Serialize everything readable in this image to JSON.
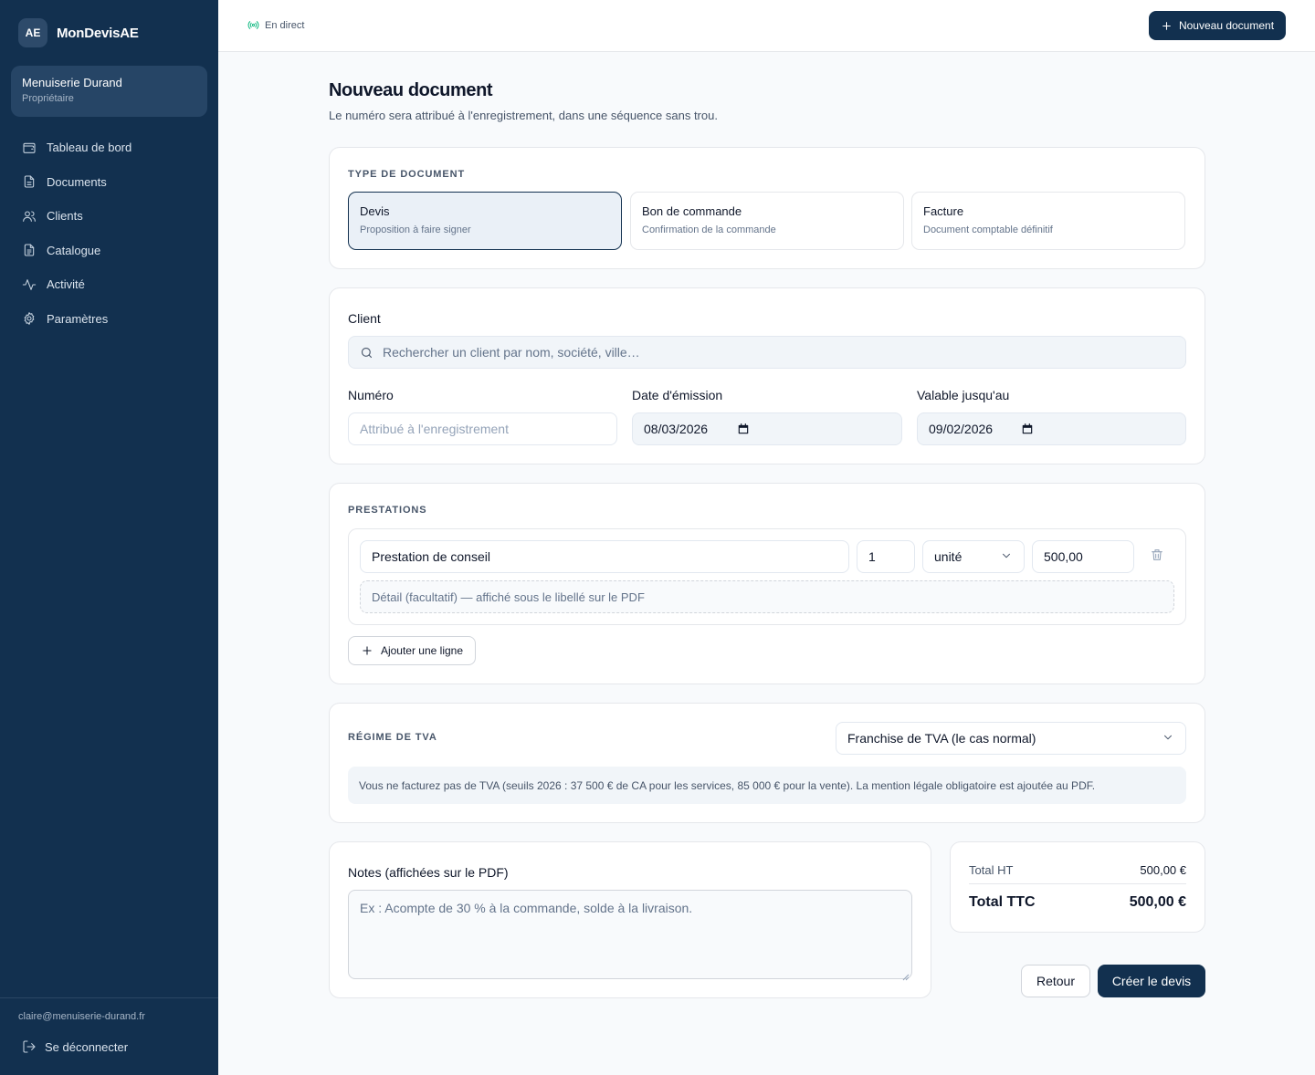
{
  "sidebar": {
    "brand_badge": "AE",
    "brand_name": "MonDevisAE",
    "org_name": "Menuiserie Durand",
    "org_role": "Propriétaire",
    "items": [
      {
        "label": "Tableau de bord",
        "icon": "wallet-icon"
      },
      {
        "label": "Documents",
        "icon": "document-icon"
      },
      {
        "label": "Clients",
        "icon": "users-icon"
      },
      {
        "label": "Catalogue",
        "icon": "catalog-icon"
      },
      {
        "label": "Activité",
        "icon": "activity-icon"
      },
      {
        "label": "Paramètres",
        "icon": "gear-icon"
      }
    ],
    "email": "claire@menuiserie-durand.fr",
    "logout": "Se déconnecter"
  },
  "topbar": {
    "live": "En direct",
    "new_document": "Nouveau document"
  },
  "page": {
    "title": "Nouveau document",
    "subtitle": "Le numéro sera attribué à l'enregistrement, dans une séquence sans trou."
  },
  "doc_type": {
    "label": "Type de document",
    "options": [
      {
        "name": "Devis",
        "desc": "Proposition à faire signer",
        "selected": true
      },
      {
        "name": "Bon de commande",
        "desc": "Confirmation de la commande",
        "selected": false
      },
      {
        "name": "Facture",
        "desc": "Document comptable définitif",
        "selected": false
      }
    ]
  },
  "client": {
    "label": "Client",
    "search_placeholder": "Rechercher un client par nom, société, ville…",
    "numero_label": "Numéro",
    "numero_placeholder": "Attribué à l'enregistrement",
    "date_label": "Date d'émission",
    "date_value": "08/03/2026",
    "valid_label": "Valable jusqu'au",
    "valid_value": "09/02/2026"
  },
  "prestations": {
    "label": "Prestations",
    "lines": [
      {
        "label": "Prestation de conseil",
        "qty": "1",
        "unit": "unité",
        "price": "500,00",
        "detail_placeholder": "Détail (facultatif) — affiché sous le libellé sur le PDF"
      }
    ],
    "add_line": "Ajouter une ligne"
  },
  "tva": {
    "label": "Régime de TVA",
    "selected": "Franchise de TVA (le cas normal)",
    "info": "Vous ne facturez pas de TVA (seuils 2026 : 37 500 € de CA pour les services, 85 000 € pour la vente). La mention légale obligatoire est ajoutée au PDF."
  },
  "notes": {
    "label": "Notes (affichées sur le PDF)",
    "placeholder": "Ex : Acompte de 30 % à la commande, solde à la livraison."
  },
  "totals": {
    "ht_label": "Total HT",
    "ht_value": "500,00 €",
    "ttc_label": "Total TTC",
    "ttc_value": "500,00 €"
  },
  "actions": {
    "back": "Retour",
    "create": "Créer le devis"
  }
}
